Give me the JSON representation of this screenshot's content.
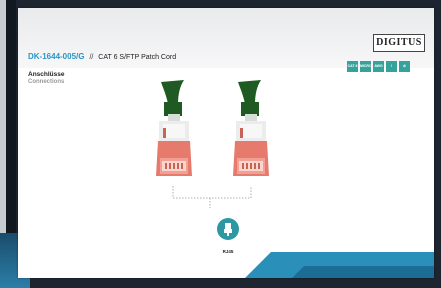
{
  "brand": {
    "logo_text": "DIGITUS"
  },
  "product": {
    "code": "DK-1644-005/G",
    "separator": "//",
    "description": "CAT 6 S/FTP Patch Cord"
  },
  "section": {
    "title": "Anschlüsse",
    "subtitle": "Connections"
  },
  "feature_badges": [
    {
      "label": "CAT 6",
      "color": "#35a39c"
    },
    {
      "label": "MICRO",
      "color": "#35a39c"
    },
    {
      "label": "AWG",
      "color": "#35a39c"
    },
    {
      "label": "!",
      "color": "#35a39c"
    },
    {
      "label": "⊘",
      "color": "#35a39c"
    }
  ],
  "connectors": [
    {
      "type": "rj45-plug-left"
    },
    {
      "type": "rj45-plug-right"
    }
  ],
  "connector_icon": {
    "caption": "RJ45"
  },
  "colors": {
    "accent": "#2a94c9",
    "cable": "#1e5a22",
    "plug_boot": "#e67a6c",
    "badge": "#35a39c"
  }
}
